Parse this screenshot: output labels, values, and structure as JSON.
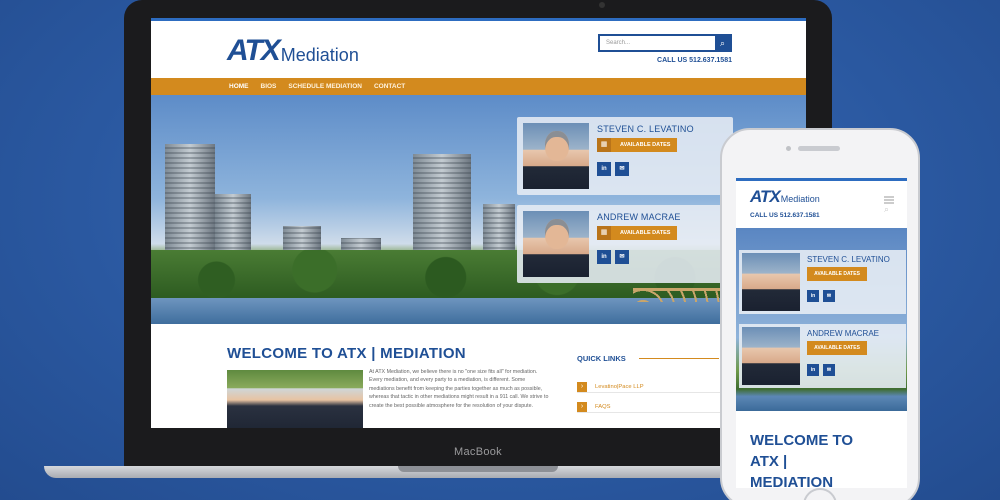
{
  "site": {
    "logo_mark": "ATX",
    "logo_text": "Mediation",
    "search_placeholder": "Search...",
    "search_icon": "search-icon",
    "call": "CALL US 512.637.1581",
    "nav": [
      "HOME",
      "BIOS",
      "SCHEDULE MEDIATION",
      "CONTACT"
    ],
    "profiles": [
      {
        "name": "STEVEN C. LEVATINO",
        "dates_label": "AVAILABLE DATES",
        "linkedin": "in",
        "email": "✉"
      },
      {
        "name": "ANDREW MACRAE",
        "dates_label": "AVAILABLE DATES",
        "linkedin": "in",
        "email": "✉"
      }
    ],
    "welcome_title": "WELCOME TO ATX | MEDIATION",
    "welcome_text": "At ATX Mediation, we believe there is no \"one size fits all\" for mediation. Every mediation, and every party to a mediation, is different. Some mediations benefit from keeping the parties together as much as possible, whereas that tactic in other mediations might result in a 911 call. We strive to create the best possible atmosphere for the resolution of your dispute.",
    "quick_links_title": "QUICK LINKS",
    "quick_links": [
      "Levatino|Pace LLP",
      "FAQS"
    ]
  },
  "device": {
    "laptop_label": "MacBook"
  },
  "mobile": {
    "logo_mark": "ATX",
    "logo_text": "Mediation",
    "call": "CALL US 512.637.1581",
    "welcome_title": "WELCOME TO ATX | MEDIATION"
  },
  "colors": {
    "brand_blue": "#1f4f95",
    "accent_orange": "#d38a1e",
    "background": "#2c5aa0"
  }
}
